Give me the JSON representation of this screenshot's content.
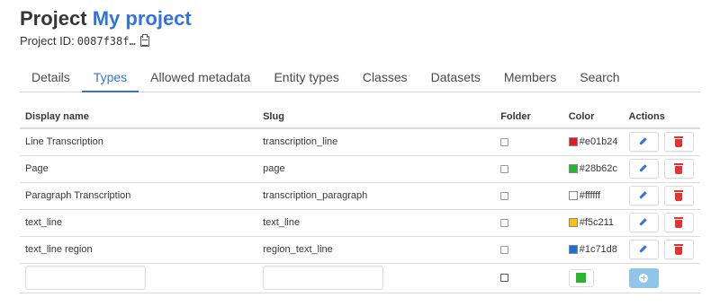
{
  "header": {
    "title_prefix": "Project",
    "project_name": "My project",
    "id_label": "Project ID:",
    "id_value": "0087f38f…",
    "copy_icon": "clipboard-icon"
  },
  "tabs": [
    {
      "label": "Details",
      "active": false
    },
    {
      "label": "Types",
      "active": true
    },
    {
      "label": "Allowed metadata",
      "active": false
    },
    {
      "label": "Entity types",
      "active": false
    },
    {
      "label": "Classes",
      "active": false
    },
    {
      "label": "Datasets",
      "active": false
    },
    {
      "label": "Members",
      "active": false
    },
    {
      "label": "Search",
      "active": false
    }
  ],
  "table": {
    "columns": [
      "Display name",
      "Slug",
      "Folder",
      "Color",
      "Actions"
    ],
    "rows": [
      {
        "display_name": "Line Transcription",
        "slug": "transcription_line",
        "folder": false,
        "color": "#e01b24",
        "color_label": "#e01b24"
      },
      {
        "display_name": "Page",
        "slug": "page",
        "folder": false,
        "color": "#28b62c",
        "color_label": "#28b62c"
      },
      {
        "display_name": "Paragraph Transcription",
        "slug": "transcription_paragraph",
        "folder": false,
        "color": "#ffffff",
        "color_label": "#ffffff"
      },
      {
        "display_name": "text_line",
        "slug": "text_line",
        "folder": false,
        "color": "#f5c211",
        "color_label": "#f5c211"
      },
      {
        "display_name": "text_line region",
        "slug": "region_text_line",
        "folder": false,
        "color": "#1c71d8",
        "color_label": "#1c71d8"
      }
    ],
    "new_row": {
      "display_name_value": "",
      "slug_value": "",
      "folder": false,
      "color": "#28b62c"
    },
    "actions": {
      "edit_icon": "pencil-icon",
      "delete_icon": "trash-icon",
      "add_icon": "plus-circle-icon"
    }
  },
  "colors": {
    "accent": "#3273dc",
    "danger": "#e3342f",
    "add_button": "#8ec5e8"
  }
}
